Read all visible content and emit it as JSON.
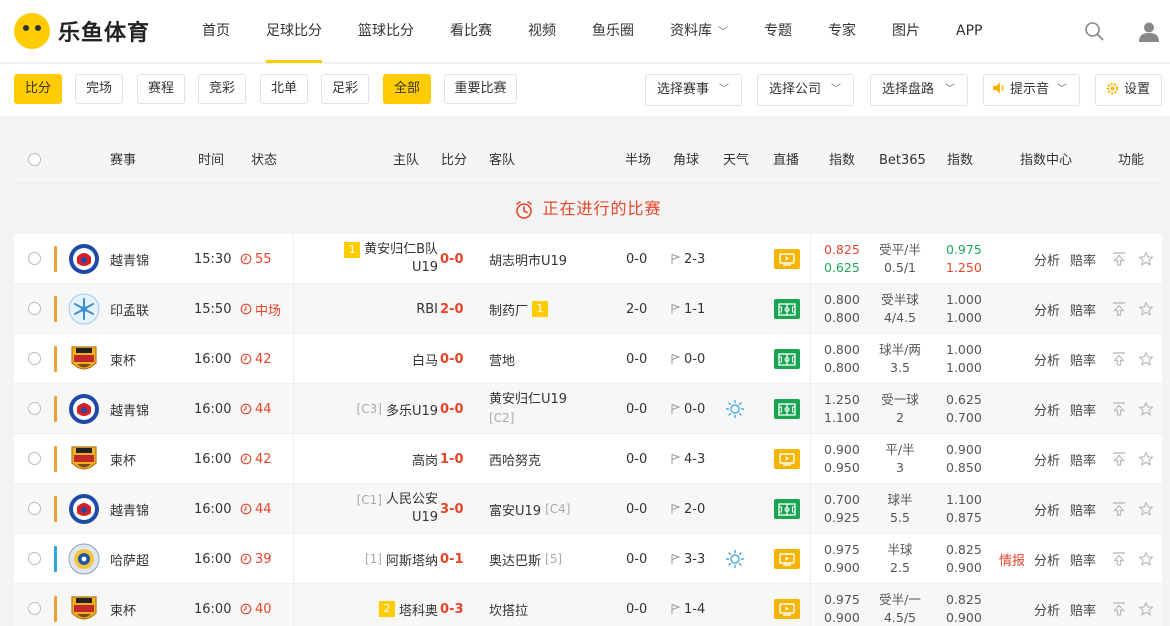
{
  "brand": {
    "name": "乐鱼体育"
  },
  "nav": [
    {
      "label": "首页",
      "active": false,
      "dropdown": false
    },
    {
      "label": "足球比分",
      "active": true,
      "dropdown": false
    },
    {
      "label": "篮球比分",
      "active": false,
      "dropdown": false
    },
    {
      "label": "看比赛",
      "active": false,
      "dropdown": false
    },
    {
      "label": "视频",
      "active": false,
      "dropdown": false
    },
    {
      "label": "鱼乐圈",
      "active": false,
      "dropdown": false
    },
    {
      "label": "资料库",
      "active": false,
      "dropdown": true
    },
    {
      "label": "专题",
      "active": false,
      "dropdown": false
    },
    {
      "label": "专家",
      "active": false,
      "dropdown": false
    },
    {
      "label": "图片",
      "active": false,
      "dropdown": false
    },
    {
      "label": "APP",
      "active": false,
      "dropdown": false
    }
  ],
  "filters": {
    "tabs": [
      {
        "label": "比分",
        "on": true
      },
      {
        "label": "完场",
        "on": false
      },
      {
        "label": "赛程",
        "on": false
      },
      {
        "label": "竞彩",
        "on": false
      },
      {
        "label": "北单",
        "on": false
      },
      {
        "label": "足彩",
        "on": false
      },
      {
        "label": "全部",
        "on": true
      },
      {
        "label": "重要比赛",
        "on": false
      }
    ],
    "selects": {
      "league": "选择赛事",
      "company": "选择公司",
      "handicap": "选择盘路",
      "sound": "提示音",
      "settings": "设置"
    }
  },
  "columns": {
    "league": "赛事",
    "time": "时间",
    "status": "状态",
    "home": "主队",
    "score": "比分",
    "away": "客队",
    "half": "半场",
    "corner": "角球",
    "weather": "天气",
    "live": "直播",
    "index1": "指数",
    "bet365": "Bet365",
    "index2": "指数",
    "index_center": "指数中心",
    "func": "功能"
  },
  "section_title": "正在进行的比赛",
  "actions": {
    "analysis": "分析",
    "odds": "赔率",
    "intel": "情报"
  },
  "colors": {
    "accent": "#ffcc00",
    "live_red": "#e8442a",
    "up": "#e8442a",
    "down": "#1ea858",
    "tv_yellow": "#f5b400",
    "tv_green": "#19a453"
  },
  "matches": [
    {
      "league": "越青锦",
      "league_icon": "vietnam-badge",
      "bar_color": "#f0a030",
      "time": "15:30",
      "status": "55",
      "home_rank": "",
      "home": "黄安归仁B队",
      "home_line2": "U19",
      "home_badge": "1",
      "score": "0-0",
      "away": "胡志明市U19",
      "away_rank": "",
      "away_badge": "",
      "half": "0-0",
      "corner": "2-3",
      "weather": "",
      "tv": "y",
      "i1a": "0.825",
      "i1a_dir": "up",
      "i1b": "0.625",
      "i1b_dir": "dn",
      "hc": "受平/半",
      "hc2": "0.5/1",
      "i2a": "0.975",
      "i2a_dir": "dn",
      "i2b": "1.250",
      "i2b_dir": "up",
      "intel": false
    },
    {
      "league": "印孟联",
      "league_icon": "snowflake-badge",
      "bar_color": "#f0a030",
      "time": "15:50",
      "status": "中场",
      "home_rank": "",
      "home": "RBI",
      "home_line2": "",
      "home_badge": "",
      "score": "2-0",
      "away": "制药厂",
      "away_rank": "",
      "away_badge": "1",
      "half": "2-0",
      "corner": "1-1",
      "weather": "",
      "tv": "g",
      "i1a": "0.800",
      "i1a_dir": "",
      "i1b": "0.800",
      "i1b_dir": "",
      "hc": "受半球",
      "hc2": "4/4.5",
      "i2a": "1.000",
      "i2a_dir": "",
      "i2b": "1.000",
      "i2b_dir": "",
      "intel": false
    },
    {
      "league": "柬杯",
      "league_icon": "burger-badge",
      "bar_color": "#f0a030",
      "time": "16:00",
      "status": "42",
      "home_rank": "",
      "home": "白马",
      "home_line2": "",
      "home_badge": "",
      "score": "0-0",
      "away": "营地",
      "away_rank": "",
      "away_badge": "",
      "half": "0-0",
      "corner": "0-0",
      "weather": "",
      "tv": "g",
      "i1a": "0.800",
      "i1a_dir": "",
      "i1b": "0.800",
      "i1b_dir": "",
      "hc": "球半/两",
      "hc2": "3.5",
      "i2a": "1.000",
      "i2a_dir": "",
      "i2b": "1.000",
      "i2b_dir": "",
      "intel": false
    },
    {
      "league": "越青锦",
      "league_icon": "vietnam-badge",
      "bar_color": "#f0a030",
      "time": "16:00",
      "status": "44",
      "home_rank": "[C3]",
      "home": "多乐U19",
      "home_line2": "",
      "home_badge": "",
      "score": "0-0",
      "away": "黄安归仁U19",
      "away_rank": "[C2]",
      "away_badge": "",
      "half": "0-0",
      "corner": "0-0",
      "weather": "sun",
      "tv": "g",
      "i1a": "1.250",
      "i1a_dir": "",
      "i1b": "1.100",
      "i1b_dir": "",
      "hc": "受一球",
      "hc2": "2",
      "i2a": "0.625",
      "i2a_dir": "",
      "i2b": "0.700",
      "i2b_dir": "",
      "intel": false
    },
    {
      "league": "柬杯",
      "league_icon": "burger-badge",
      "bar_color": "#f0a030",
      "time": "16:00",
      "status": "42",
      "home_rank": "",
      "home": "高岗",
      "home_line2": "",
      "home_badge": "",
      "score": "1-0",
      "away": "西哈努克",
      "away_rank": "",
      "away_badge": "",
      "half": "0-0",
      "corner": "4-3",
      "weather": "",
      "tv": "y",
      "i1a": "0.900",
      "i1a_dir": "",
      "i1b": "0.950",
      "i1b_dir": "",
      "hc": "平/半",
      "hc2": "3",
      "i2a": "0.900",
      "i2a_dir": "",
      "i2b": "0.850",
      "i2b_dir": "",
      "intel": false
    },
    {
      "league": "越青锦",
      "league_icon": "vietnam-badge",
      "bar_color": "#f0a030",
      "time": "16:00",
      "status": "44",
      "home_rank": "[C1]",
      "home": "人民公安",
      "home_line2": "U19",
      "home_badge": "",
      "score": "3-0",
      "away": "富安U19",
      "away_rank": "[C4]",
      "away_badge": "",
      "half": "0-0",
      "corner": "2-0",
      "weather": "",
      "tv": "g",
      "i1a": "0.700",
      "i1a_dir": "",
      "i1b": "0.925",
      "i1b_dir": "",
      "hc": "球半",
      "hc2": "5.5",
      "i2a": "1.100",
      "i2a_dir": "",
      "i2b": "0.875",
      "i2b_dir": "",
      "intel": false
    },
    {
      "league": "哈萨超",
      "league_icon": "kazakh-badge",
      "bar_color": "#2aa7d8",
      "time": "16:00",
      "status": "39",
      "home_rank": "[1]",
      "home": "阿斯塔纳",
      "home_line2": "",
      "home_badge": "",
      "score": "0-1",
      "away": "奥达巴斯",
      "away_rank": "[5]",
      "away_badge": "",
      "half": "0-0",
      "corner": "3-3",
      "weather": "sun",
      "tv": "y",
      "i1a": "0.975",
      "i1a_dir": "",
      "i1b": "0.900",
      "i1b_dir": "",
      "hc": "半球",
      "hc2": "2.5",
      "i2a": "0.825",
      "i2a_dir": "",
      "i2b": "0.900",
      "i2b_dir": "",
      "intel": true
    },
    {
      "league": "柬杯",
      "league_icon": "burger-badge",
      "bar_color": "#f0a030",
      "time": "16:00",
      "status": "40",
      "home_rank": "",
      "home": "塔科奥",
      "home_line2": "",
      "home_badge": "2",
      "score": "0-3",
      "away": "坎搭拉",
      "away_rank": "",
      "away_badge": "",
      "half": "0-0",
      "corner": "1-4",
      "weather": "",
      "tv": "y",
      "i1a": "0.975",
      "i1a_dir": "",
      "i1b": "0.900",
      "i1b_dir": "",
      "hc": "受半/一",
      "hc2": "4.5/5",
      "i2a": "0.825",
      "i2a_dir": "",
      "i2b": "0.900",
      "i2b_dir": "",
      "intel": false
    }
  ]
}
